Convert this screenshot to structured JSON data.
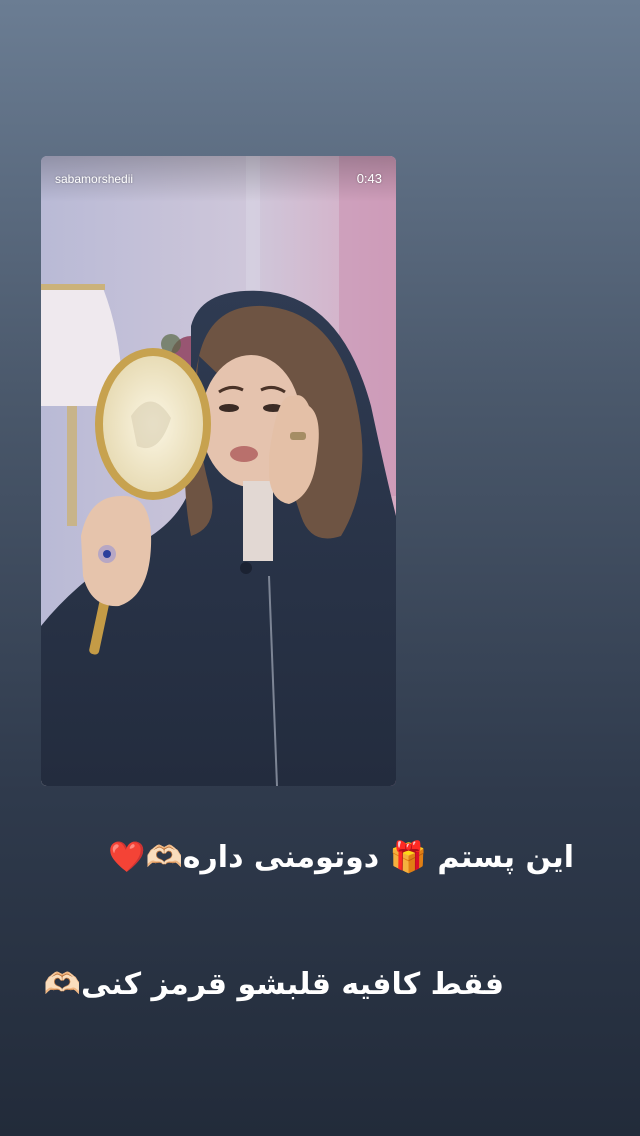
{
  "reel": {
    "username": "sabamorshedii",
    "duration": "0:43"
  },
  "captions": {
    "line1": "این پستم 🎁 دوتومنی داره🫶🏻❤️",
    "line2": "فقط کافیه قلبشو قرمز کنی🫶🏻"
  },
  "colors": {
    "background_top": "#6b7d93",
    "background_bottom": "#222b3a",
    "caption_text": "#ffffff"
  }
}
